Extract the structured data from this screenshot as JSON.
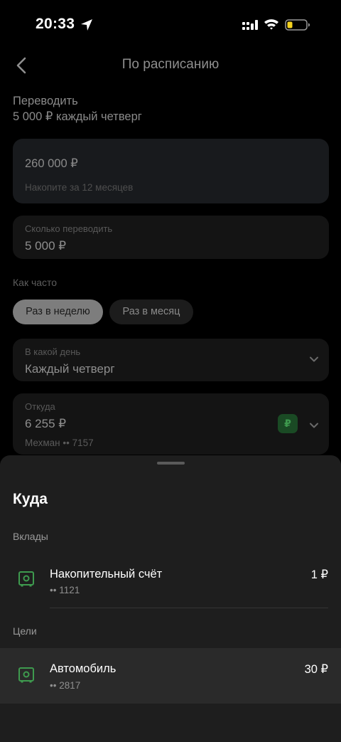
{
  "status_bar": {
    "time": "20:33"
  },
  "header": {
    "title": "По расписанию"
  },
  "intro": {
    "line1": "Переводить",
    "line2": "5 000 ₽ каждый четверг"
  },
  "goal": {
    "amount": "260 000 ₽",
    "hint": "Накопите за 12 месяцев"
  },
  "amount_field": {
    "label": "Сколько переводить",
    "value": "5 000 ₽"
  },
  "frequency": {
    "label": "Как часто",
    "options": [
      "Раз в неделю",
      "Раз в месяц"
    ],
    "selected": "Раз в неделю"
  },
  "day_field": {
    "label": "В какой день",
    "value": "Каждый четверг"
  },
  "from_field": {
    "label": "Откуда",
    "balance": "6 255 ₽",
    "owner": "Мехман •• 7157",
    "badge": "₽"
  },
  "sheet": {
    "title": "Куда",
    "sections": [
      {
        "label": "Вклады",
        "items": [
          {
            "name": "Накопительный счёт",
            "number": "•• 1121",
            "balance": "1 ₽"
          }
        ]
      },
      {
        "label": "Цели",
        "items": [
          {
            "name": "Автомобиль",
            "number": "•• 2817",
            "balance": "30 ₽"
          }
        ]
      }
    ]
  },
  "colors": {
    "accent_green": "#3e9a4e",
    "sheet_bg": "#1e1e1e",
    "highlight_row": "#2a2a2a"
  }
}
